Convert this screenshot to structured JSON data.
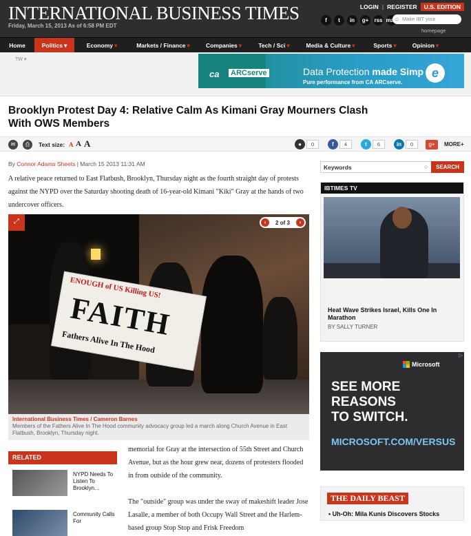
{
  "header": {
    "logo": "International Business Times",
    "dateline": "Friday, March 15, 2013 As of 6:58 PM EDT",
    "login": "LOGIN",
    "register": "REGISTER",
    "edition": "U.S. EDITION",
    "search_placeholder": "Make IBT your",
    "homepage": "homepage",
    "social_icons": [
      "f",
      "t",
      "in",
      "g+",
      "rss",
      "mail"
    ]
  },
  "nav": {
    "items": [
      {
        "label": "Home",
        "arrow": ""
      },
      {
        "label": "Politics",
        "arrow": "▾"
      },
      {
        "label": "Economy",
        "arrow": "▾"
      },
      {
        "label": "Markets / Finance",
        "arrow": "▾"
      },
      {
        "label": "Companies",
        "arrow": "▾"
      },
      {
        "label": "Tech / Sci",
        "arrow": "▾"
      },
      {
        "label": "Media & Culture",
        "arrow": "▾"
      },
      {
        "label": "Sports",
        "arrow": "▾"
      },
      {
        "label": "Opinion",
        "arrow": "▾"
      }
    ],
    "tw": "TW ▾"
  },
  "banner": {
    "brand": "ca",
    "product": "ARCserve",
    "line1_a": "Data Protection ",
    "line1_b": "made Simp",
    "line2": "Pure performance from CA ARCserve."
  },
  "article": {
    "headline": "Brooklyn Protest Day 4: Relative Calm As Kimani Gray Mourners Clash With OWS Members",
    "text_size_label": "Text size:",
    "by": "By",
    "author": "Connor Adams Sheets",
    "date": "| March 15 2013 11:31 AM",
    "lede": "A relative peace returned to East Flatbush, Brooklyn, Thursday night as the fourth straight day of protests against the NYPD over the Saturday shooting death of 16-year-old Kimani \"Kiki\" Gray at the hands of two undercover officers.",
    "pager": "2 of 3",
    "banner_line1": "ENOUGH of US Killing US!",
    "banner_line2": "FAITH",
    "banner_line3": "Fathers Alive In The Hood",
    "caption_source": "International Business Times / Cameron Barnes",
    "caption": "Members of the Fathers Alive In The Hood community advocacy group led a march along Church Avenue in East Flatbush, Brooklyn, Thursday night.",
    "body": "memorial for Gray at the intersection of 55th Street and Church Avenue, but as the hour grew near, dozens of protesters flooded in from outside of the community.",
    "body2": "The \"outside\" group was under the sway of makeshift leader Jose Lasalle, a member of both Occupy Wall Street and the Harlem-based group Stop Stop and Frisk Freedom"
  },
  "share": {
    "counts": [
      "0",
      "4",
      "6",
      "0"
    ],
    "more": "MORE+"
  },
  "related": {
    "title": "RELATED",
    "items": [
      "NYPD Needs To Listen To Brooklyn…",
      "Community Calls For"
    ]
  },
  "sidebar": {
    "search_value": "Keywords",
    "search_btn": "SEARCH",
    "tv_title": "IBTIMES TV",
    "tv_headline": "Heat Wave Strikes Israel, Kills One In Marathon",
    "tv_by": "BY SALLY TURNER",
    "ad_brand": "Microsoft",
    "ad_line1": "SEE MORE",
    "ad_line2": "REASONS",
    "ad_line3": "TO SWITCH.",
    "ad_url": "MICROSOFT.COM/VERSUS",
    "beast_title": "THE DAILY BEAST",
    "beast_item": "Uh-Oh: Mila Kunis Discovers Stocks"
  },
  "colors": {
    "accent": "#c8351c",
    "header": "#2e2e2e",
    "nav": "#1f1f1f",
    "facebook": "#3b5998",
    "twitter": "#2aa9e0",
    "linkedin": "#0e76a8",
    "google": "#d34836"
  }
}
